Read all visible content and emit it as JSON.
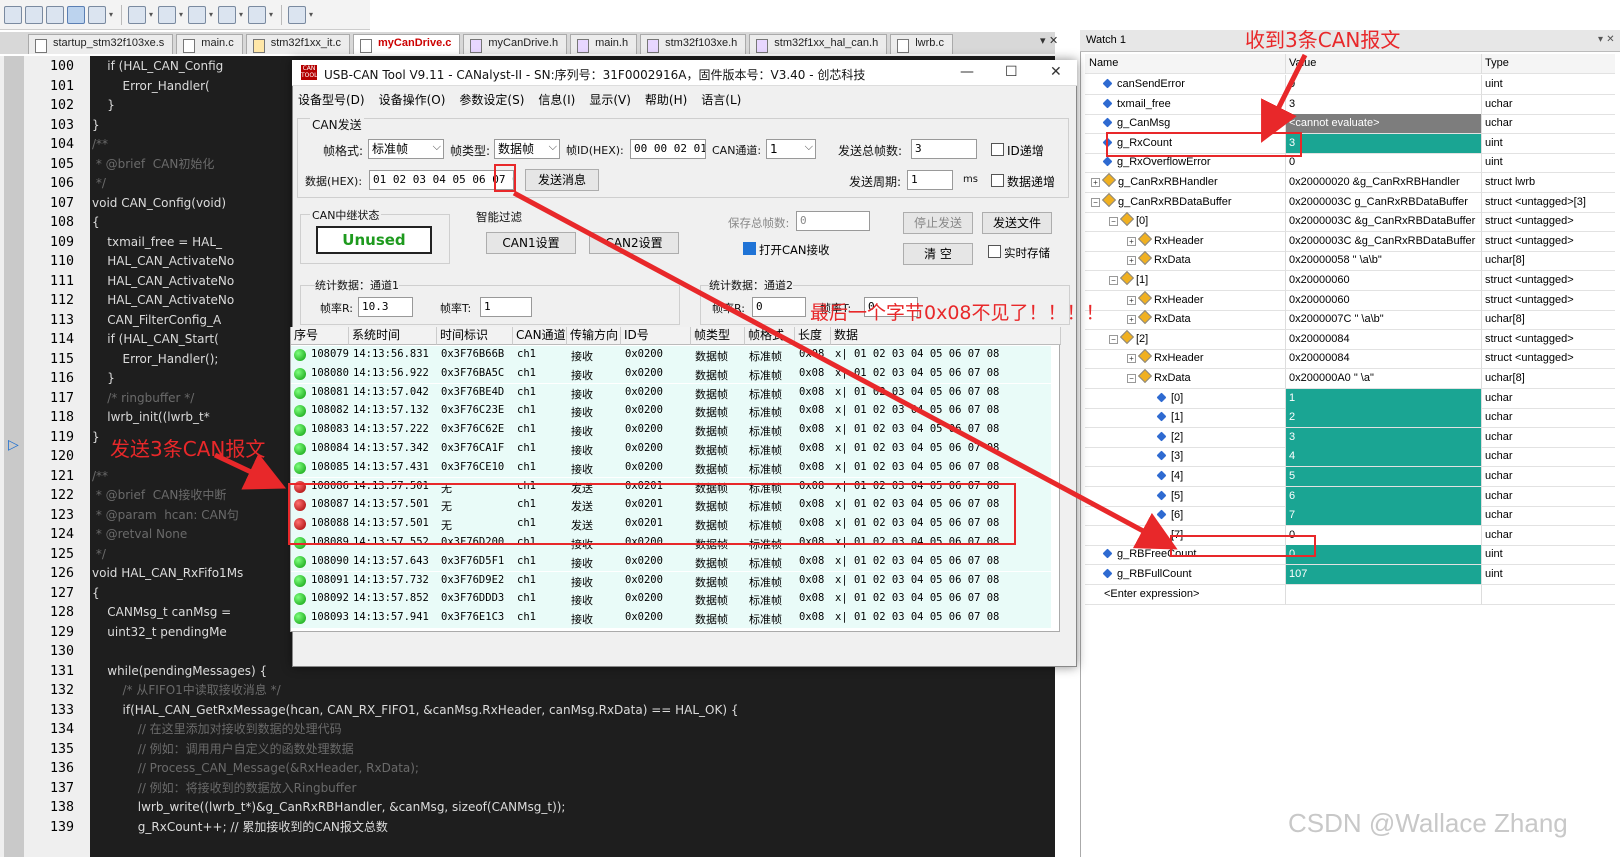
{
  "tabs": [
    "startup_stm32f103xe.s",
    "main.c",
    "stm32f1xx_it.c",
    "myCanDrive.c",
    "myCanDrive.h",
    "main.h",
    "stm32f103xe.h",
    "stm32f1xx_hal_can.h",
    "lwrb.c"
  ],
  "tab_menu": "▾ ✕",
  "code_lines": [
    {
      "n": "100",
      "t": "    if (HAL_CAN_Config"
    },
    {
      "n": "101",
      "t": "        Error_Handler("
    },
    {
      "n": "102",
      "t": "    }"
    },
    {
      "n": "103",
      "t": "}"
    },
    {
      "n": "104",
      "t": "/**"
    },
    {
      "n": "105",
      "t": " * @brief  CAN初始化"
    },
    {
      "n": "106",
      "t": " */"
    },
    {
      "n": "107",
      "t": "void CAN_Config(void)"
    },
    {
      "n": "108",
      "t": "{"
    },
    {
      "n": "109",
      "t": "    txmail_free = HAL_"
    },
    {
      "n": "110",
      "t": "    HAL_CAN_ActivateNo"
    },
    {
      "n": "111",
      "t": "    HAL_CAN_ActivateNo"
    },
    {
      "n": "112",
      "t": "    HAL_CAN_ActivateNo"
    },
    {
      "n": "113",
      "t": "    CAN_FilterConfig_A"
    },
    {
      "n": "114",
      "t": "    if (HAL_CAN_Start("
    },
    {
      "n": "115",
      "t": "        Error_Handler();"
    },
    {
      "n": "116",
      "t": "    }"
    },
    {
      "n": "117",
      "t": "    /* ringbuffer */"
    },
    {
      "n": "118",
      "t": "    lwrb_init((lwrb_t*"
    },
    {
      "n": "119",
      "t": "}"
    },
    {
      "n": "120",
      "t": ""
    },
    {
      "n": "121",
      "t": "/**"
    },
    {
      "n": "122",
      "t": " * @brief  CAN接收中断"
    },
    {
      "n": "123",
      "t": " * @param  hcan: CAN句"
    },
    {
      "n": "124",
      "t": " * @retval None"
    },
    {
      "n": "125",
      "t": " */"
    },
    {
      "n": "126",
      "t": "void HAL_CAN_RxFifo1Ms"
    },
    {
      "n": "127",
      "t": "{"
    },
    {
      "n": "128",
      "t": "    CANMsg_t canMsg = "
    },
    {
      "n": "129",
      "t": "    uint32_t pendingMe"
    },
    {
      "n": "130",
      "t": ""
    },
    {
      "n": "131",
      "t": "    while(pendingMessages) {"
    },
    {
      "n": "132",
      "t": "        /* 从FIFO1中读取接收消息 */"
    },
    {
      "n": "133",
      "t": "        if(HAL_CAN_GetRxMessage(hcan, CAN_RX_FIFO1, &canMsg.RxHeader, canMsg.RxData) == HAL_OK) {"
    },
    {
      "n": "134",
      "t": "            // 在这里添加对接收到数据的处理代码"
    },
    {
      "n": "135",
      "t": "            // 例如：调用用户自定义的函数处理数据"
    },
    {
      "n": "136",
      "t": "            // Process_CAN_Message(&RxHeader, RxData);"
    },
    {
      "n": "137",
      "t": "            // 例如：将接收到的数据放入Ringbuffer"
    },
    {
      "n": "138",
      "t": "            lwrb_write((lwrb_t*)&g_CanRxRBHandler, &canMsg, sizeof(CANMsg_t));"
    },
    {
      "n": "139",
      "t": "            g_RxCount++; // 累加接收到的CAN报文总数"
    }
  ],
  "watch": {
    "title": "Watch 1",
    "headers": [
      "Name",
      "Value",
      "Type"
    ],
    "rows": [
      {
        "indent": 0,
        "exp": "",
        "icon": "dot",
        "name": "canSendError",
        "value": "0",
        "type": "uint",
        "hl": ""
      },
      {
        "indent": 0,
        "exp": "",
        "icon": "dot",
        "name": "txmail_free",
        "value": "3",
        "type": "uchar",
        "hl": ""
      },
      {
        "indent": 0,
        "exp": "",
        "icon": "dot",
        "name": "g_CanMsg",
        "value": "<cannot evaluate>",
        "type": "uchar",
        "hl": "grey"
      },
      {
        "indent": 0,
        "exp": "",
        "icon": "dot",
        "name": "g_RxCount",
        "value": "3",
        "type": "uint",
        "hl": "teal"
      },
      {
        "indent": 0,
        "exp": "",
        "icon": "dot",
        "name": "g_RxOverflowError",
        "value": "0",
        "type": "uint",
        "hl": ""
      },
      {
        "indent": 0,
        "exp": "+",
        "icon": "struct",
        "name": "g_CanRxRBHandler",
        "value": "0x20000020 &g_CanRxRBHandler",
        "type": "struct lwrb",
        "hl": ""
      },
      {
        "indent": 0,
        "exp": "-",
        "icon": "struct",
        "name": "g_CanRxRBDataBuffer",
        "value": "0x2000003C g_CanRxRBDataBuffer",
        "type": "struct <untagged>[3]",
        "hl": ""
      },
      {
        "indent": 1,
        "exp": "-",
        "icon": "struct",
        "name": "[0]",
        "value": "0x2000003C &g_CanRxRBDataBuffer",
        "type": "struct <untagged>",
        "hl": ""
      },
      {
        "indent": 2,
        "exp": "+",
        "icon": "struct",
        "name": "RxHeader",
        "value": "0x2000003C &g_CanRxRBDataBuffer",
        "type": "struct <untagged>",
        "hl": ""
      },
      {
        "indent": 2,
        "exp": "+",
        "icon": "struct",
        "name": "RxData",
        "value": "0x20000058 \"\u0001 \u0002\u0003\u0004\u0005\\a\\b\"",
        "type": "uchar[8]",
        "hl": ""
      },
      {
        "indent": 1,
        "exp": "-",
        "icon": "struct",
        "name": "[1]",
        "value": "0x20000060",
        "type": "struct <untagged>",
        "hl": ""
      },
      {
        "indent": 2,
        "exp": "+",
        "icon": "struct",
        "name": "RxHeader",
        "value": "0x20000060",
        "type": "struct <untagged>",
        "hl": ""
      },
      {
        "indent": 2,
        "exp": "+",
        "icon": "struct",
        "name": "RxData",
        "value": "0x2000007C \"\u0001 \u0002\u0003\u0004\u0005\\a\\b\"",
        "type": "uchar[8]",
        "hl": ""
      },
      {
        "indent": 1,
        "exp": "-",
        "icon": "struct",
        "name": "[2]",
        "value": "0x20000084",
        "type": "struct <untagged>",
        "hl": ""
      },
      {
        "indent": 2,
        "exp": "+",
        "icon": "struct",
        "name": "RxHeader",
        "value": "0x20000084",
        "type": "struct <untagged>",
        "hl": ""
      },
      {
        "indent": 2,
        "exp": "-",
        "icon": "struct",
        "name": "RxData",
        "value": "0x200000A0 \"\u0001 \u0002\u0003\u0004\u0005\\a\"",
        "type": "uchar[8]",
        "hl": ""
      },
      {
        "indent": 3,
        "exp": "",
        "icon": "dot",
        "name": "[0]",
        "value": "1",
        "type": "uchar",
        "hl": "teal"
      },
      {
        "indent": 3,
        "exp": "",
        "icon": "dot",
        "name": "[1]",
        "value": "2",
        "type": "uchar",
        "hl": "teal"
      },
      {
        "indent": 3,
        "exp": "",
        "icon": "dot",
        "name": "[2]",
        "value": "3",
        "type": "uchar",
        "hl": "teal"
      },
      {
        "indent": 3,
        "exp": "",
        "icon": "dot",
        "name": "[3]",
        "value": "4",
        "type": "uchar",
        "hl": "teal"
      },
      {
        "indent": 3,
        "exp": "",
        "icon": "dot",
        "name": "[4]",
        "value": "5",
        "type": "uchar",
        "hl": "teal"
      },
      {
        "indent": 3,
        "exp": "",
        "icon": "dot",
        "name": "[5]",
        "value": "6",
        "type": "uchar",
        "hl": "teal"
      },
      {
        "indent": 3,
        "exp": "",
        "icon": "dot",
        "name": "[6]",
        "value": "7",
        "type": "uchar",
        "hl": "teal"
      },
      {
        "indent": 3,
        "exp": "",
        "icon": "dot",
        "name": "[7]",
        "value": "0",
        "type": "uchar",
        "hl": ""
      },
      {
        "indent": 0,
        "exp": "",
        "icon": "dot",
        "name": "g_RBFreeCount",
        "value": "0",
        "type": "uint",
        "hl": "teal"
      },
      {
        "indent": 0,
        "exp": "",
        "icon": "dot",
        "name": "g_RBFullCount",
        "value": "107",
        "type": "uint",
        "hl": "teal"
      },
      {
        "indent": 0,
        "exp": "",
        "icon": "",
        "name": "<Enter expression>",
        "value": "",
        "type": "",
        "hl": ""
      }
    ]
  },
  "tool": {
    "title": "USB-CAN Tool V9.11 - CANalyst-II - SN:序列号：31F0002916A，固件版本号：V3.40 - 创芯科技",
    "icon_text": "CAN TOOL",
    "win_min": "—",
    "win_max": "☐",
    "win_close": "✕",
    "menus": [
      "设备型号(D)",
      "设备操作(O)",
      "参数设定(S)",
      "信息(I)",
      "显示(V)",
      "帮助(H)",
      "语言(L)"
    ],
    "send_group": "CAN发送",
    "frame_format_label": "帧格式:",
    "frame_format": "标准帧",
    "frame_type_label": "帧类型:",
    "frame_type": "数据帧",
    "frame_id_label": "帧ID(HEX):",
    "frame_id": "00 00 02 01",
    "channel_label": "CAN通道:",
    "channel": "1",
    "total_label": "发送总帧数:",
    "total": "3",
    "id_inc": "ID递增",
    "data_label": "数据(HEX):",
    "data": "01 02 03 04 05 06 07 08",
    "send_btn": "发送消息",
    "period_label": "发送周期:",
    "period": "1",
    "period_unit": "ms",
    "data_inc": "数据递增",
    "relay_group": "CAN中继状态",
    "relay_state": "Unused",
    "filter_group": "智能过滤",
    "can1_btn": "CAN1设置",
    "can2_btn": "CAN2设置",
    "saved_label": "保存总帧数:",
    "saved": "0",
    "stop_btn": "停止发送",
    "file_btn": "发送文件",
    "open_recv": "打开CAN接收",
    "clear_btn": "清 空",
    "realtime": "实时存储",
    "stat1": "统计数据：通道1",
    "rate_r_label": "帧率R:",
    "rate_r": "10.3",
    "rate_t_label": "帧率T:",
    "rate_t": "1",
    "stat2": "统计数据：通道2",
    "rate_r2_label": "帧率R:",
    "rate_r2": "0",
    "rate_t2_label": "帧率T:",
    "rate_t2": "0"
  },
  "table": {
    "headers": [
      "序号",
      "系统时间",
      "时间标识",
      "CAN通道",
      "传输方向",
      "ID号",
      "帧类型",
      "帧格式",
      "长度",
      "数据"
    ],
    "rows": [
      [
        "108079",
        "14:13:56.831",
        "0x3F76B66B",
        "ch1",
        "接收",
        "0x0200",
        "数据帧",
        "标准帧",
        "0x08",
        "x| 01 02 03 04 05 06 07 08",
        "g"
      ],
      [
        "108080",
        "14:13:56.922",
        "0x3F76BA5C",
        "ch1",
        "接收",
        "0x0200",
        "数据帧",
        "标准帧",
        "0x08",
        "x| 01 02 03 04 05 06 07 08",
        "g"
      ],
      [
        "108081",
        "14:13:57.042",
        "0x3F76BE4D",
        "ch1",
        "接收",
        "0x0200",
        "数据帧",
        "标准帧",
        "0x08",
        "x| 01 02 03 04 05 06 07 08",
        "g"
      ],
      [
        "108082",
        "14:13:57.132",
        "0x3F76C23E",
        "ch1",
        "接收",
        "0x0200",
        "数据帧",
        "标准帧",
        "0x08",
        "x| 01 02 03 04 05 06 07 08",
        "g"
      ],
      [
        "108083",
        "14:13:57.222",
        "0x3F76C62E",
        "ch1",
        "接收",
        "0x0200",
        "数据帧",
        "标准帧",
        "0x08",
        "x| 01 02 03 04 05 06 07 08",
        "g"
      ],
      [
        "108084",
        "14:13:57.342",
        "0x3F76CA1F",
        "ch1",
        "接收",
        "0x0200",
        "数据帧",
        "标准帧",
        "0x08",
        "x| 01 02 03 04 05 06 07 08",
        "g"
      ],
      [
        "108085",
        "14:13:57.431",
        "0x3F76CE10",
        "ch1",
        "接收",
        "0x0200",
        "数据帧",
        "标准帧",
        "0x08",
        "x| 01 02 03 04 05 06 07 08",
        "g"
      ],
      [
        "108086",
        "14:13:57.501",
        "无",
        "ch1",
        "发送",
        "0x0201",
        "数据帧",
        "标准帧",
        "0x08",
        "x| 01 02 03 04 05 06 07 08",
        "r"
      ],
      [
        "108087",
        "14:13:57.501",
        "无",
        "ch1",
        "发送",
        "0x0201",
        "数据帧",
        "标准帧",
        "0x08",
        "x| 01 02 03 04 05 06 07 08",
        "r"
      ],
      [
        "108088",
        "14:13:57.501",
        "无",
        "ch1",
        "发送",
        "0x0201",
        "数据帧",
        "标准帧",
        "0x08",
        "x| 01 02 03 04 05 06 07 08",
        "r"
      ],
      [
        "108089",
        "14:13:57.552",
        "0x3F76D200",
        "ch1",
        "接收",
        "0x0200",
        "数据帧",
        "标准帧",
        "0x08",
        "x| 01 02 03 04 05 06 07 08",
        "g"
      ],
      [
        "108090",
        "14:13:57.643",
        "0x3F76D5F1",
        "ch1",
        "接收",
        "0x0200",
        "数据帧",
        "标准帧",
        "0x08",
        "x| 01 02 03 04 05 06 07 08",
        "g"
      ],
      [
        "108091",
        "14:13:57.732",
        "0x3F76D9E2",
        "ch1",
        "接收",
        "0x0200",
        "数据帧",
        "标准帧",
        "0x08",
        "x| 01 02 03 04 05 06 07 08",
        "g"
      ],
      [
        "108092",
        "14:13:57.852",
        "0x3F76DDD3",
        "ch1",
        "接收",
        "0x0200",
        "数据帧",
        "标准帧",
        "0x08",
        "x| 01 02 03 04 05 06 07 08",
        "g"
      ],
      [
        "108093",
        "14:13:57.941",
        "0x3F76E1C3",
        "ch1",
        "接收",
        "0x0200",
        "数据帧",
        "标准帧",
        "0x08",
        "x| 01 02 03 04 05 06 07 08",
        "g"
      ]
    ]
  },
  "annotations": {
    "recv3": "收到3条CAN报文",
    "send3": "发送3条CAN报文",
    "lost": "最后一个字节0x08不见了！！！！",
    "color": "#e8282a"
  },
  "watermark": "CSDN @Wallace Zhang"
}
